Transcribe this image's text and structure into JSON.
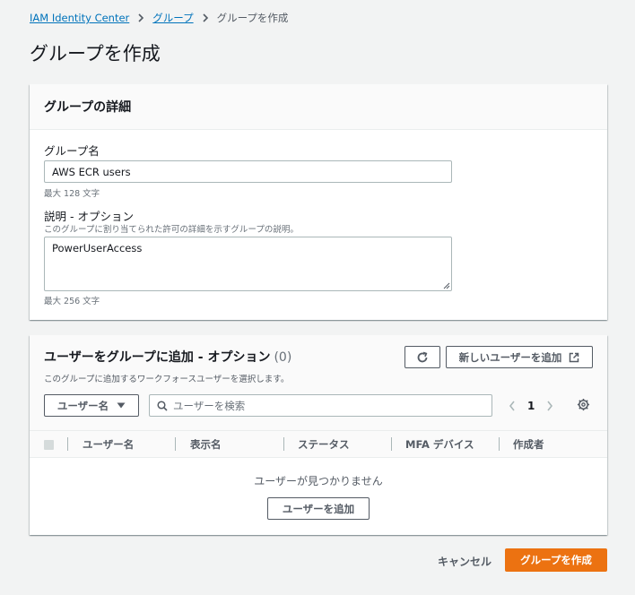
{
  "breadcrumb": {
    "items": [
      "IAM Identity Center",
      "グループ"
    ],
    "current": "グループを作成"
  },
  "page": {
    "title": "グループを作成"
  },
  "details_panel": {
    "title": "グループの詳細",
    "group_name": {
      "label": "グループ名",
      "value": "AWS ECR users",
      "constraint": "最大 128 文字"
    },
    "description": {
      "label": "説明 - オプション",
      "hint": "このグループに割り当てられた許可の詳細を示すグループの説明。",
      "value": "PowerUserAccess",
      "constraint": "最大 256 文字"
    }
  },
  "users_panel": {
    "title": "ユーザーをグループに追加 - オプション",
    "count": "(0)",
    "description": "このグループに追加するワークフォースユーザーを選択します。",
    "new_user_button": "新しいユーザーを追加",
    "filter_property": "ユーザー名",
    "search_placeholder": "ユーザーを検索",
    "current_page": "1",
    "columns": [
      "ユーザー名",
      "表示名",
      "ステータス",
      "MFA デバイス",
      "作成者"
    ],
    "empty_message": "ユーザーが見つかりません",
    "add_user_button": "ユーザーを追加"
  },
  "footer": {
    "cancel_label": "キャンセル",
    "create_label": "グループを作成"
  },
  "colors": {
    "primary": "#ec7211",
    "link": "#0073bb",
    "background": "#f2f3f3"
  }
}
